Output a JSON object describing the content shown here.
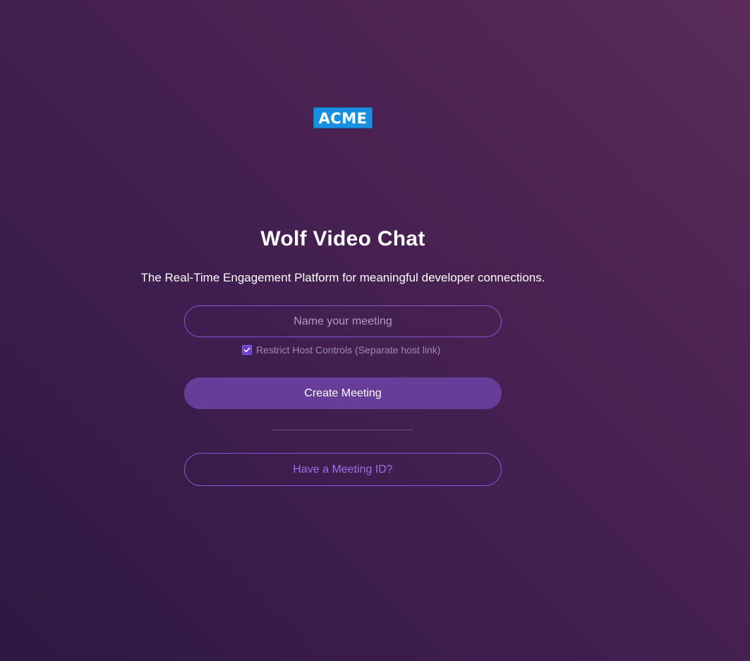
{
  "logo": {
    "text": "ACME",
    "color": "#1a8fe0"
  },
  "title": "Wolf Video Chat",
  "subtitle": "The Real-Time Engagement Platform for meaningful developer connections.",
  "meeting_name": {
    "placeholder": "Name your meeting",
    "value": ""
  },
  "restrict_host": {
    "label": "Restrict Host Controls (Separate host link)",
    "checked": true,
    "icon": "check-icon"
  },
  "create_button": {
    "label": "Create Meeting"
  },
  "meeting_id_button": {
    "label": "Have a Meeting ID?"
  },
  "colors": {
    "accent": "#683d99",
    "outline": "#8a55d6",
    "link_text": "#a46ee6"
  }
}
